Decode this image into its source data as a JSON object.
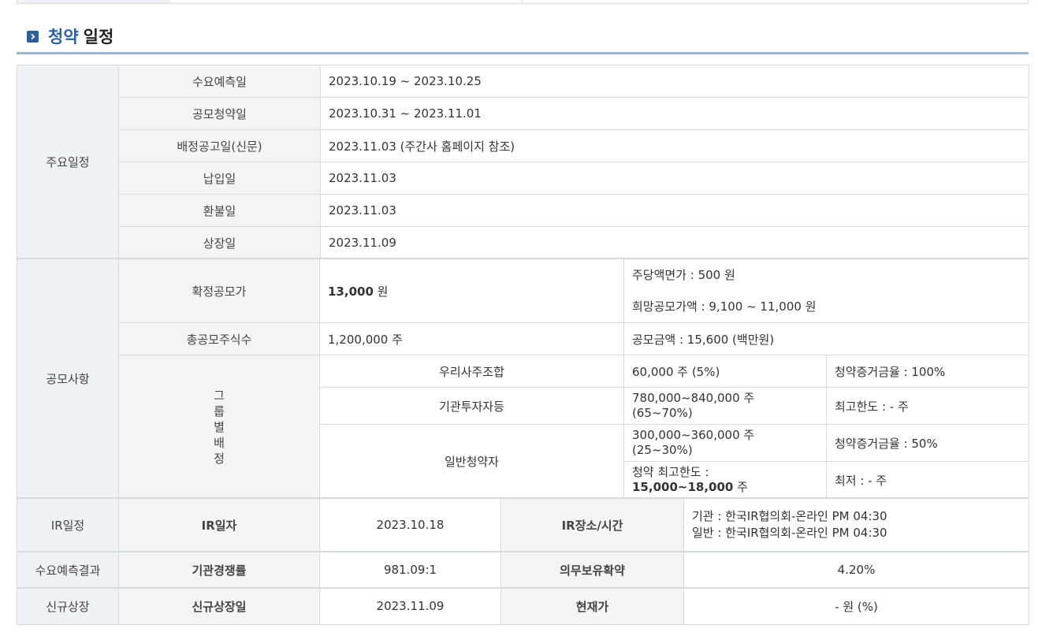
{
  "section": {
    "title_highlight": "청약",
    "title_rest": "일정",
    "icon": "chevron-right-icon"
  },
  "schedule": {
    "group_label": "주요일정",
    "rows": [
      {
        "label": "수요예측일",
        "value": "2023.10.19  ~  2023.10.25"
      },
      {
        "label": "공모청약일",
        "value": "2023.10.31  ~  2023.11.01"
      },
      {
        "label": "배정공고일(신문)",
        "value": "2023.11.03 (주간사 홈페이지 참조)"
      },
      {
        "label": "납입일",
        "value": "2023.11.03"
      },
      {
        "label": "환불일",
        "value": "2023.11.03"
      },
      {
        "label": "상장일",
        "value": "2023.11.09"
      }
    ]
  },
  "offering": {
    "group_label": "공모사항",
    "price_label": "확정공모가",
    "price_value": "13,000",
    "price_unit": " 원",
    "par_value": "주당액면가 :  500 원",
    "desired_price": "희망공모가액 :  9,100 ~ 11,000 원",
    "shares_label": "총공모주식수",
    "shares_value": "1,200,000 주",
    "amount": "공모금액 : 15,600 (백만원)",
    "alloc_label": [
      "그",
      "룹",
      "별",
      "배",
      "정"
    ],
    "esop": {
      "label": "우리사주조합",
      "shares": "60,000 주  (5%)",
      "note": "청약증거금율 : 100%"
    },
    "institution": {
      "label": "기관투자자등",
      "shares": "780,000~840,000 주 (65~70%)",
      "note": "최고한도 :  - 주"
    },
    "retail": {
      "label": "일반청약자",
      "shares": "300,000~360,000 주 (25~30%)",
      "note": "청약증거금율 : 50%",
      "limit_prefix": "청약 최고한도 :",
      "limit_value": "15,000~18,000",
      "limit_unit": " 주",
      "min_note": "최저 :  - 주"
    }
  },
  "ir": {
    "group_label": "IR일정",
    "date_label": "IR일자",
    "date_value": "2023.10.18",
    "place_label": "IR장소/시간",
    "place_line1": "기관 : 한국IR협의회-온라인 PM 04:30",
    "place_line2": "일반 : 한국IR협의회-온라인 PM 04:30"
  },
  "demand": {
    "group_label": "수요예측결과",
    "competition_label": "기관경쟁률",
    "competition_value": "981.09:1",
    "lockup_label": "의무보유확약",
    "lockup_value": "4.20%"
  },
  "listing": {
    "group_label": "신규상장",
    "date_label": "신규상장일",
    "date_value": "2023.11.09",
    "price_label": "현재가",
    "price_value": "- 원 (%)"
  }
}
